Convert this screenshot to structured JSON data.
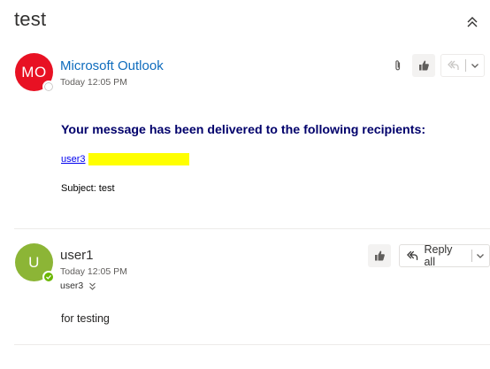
{
  "conversation": {
    "subject": "test"
  },
  "colors": {
    "accent_link": "#0f6cbd",
    "avatar_outlook": "#e81123",
    "avatar_user1": "#8cb536",
    "heading_navy": "#00006b",
    "highlight": "#ffff00",
    "presence_available": "#6bb700"
  },
  "messages": [
    {
      "avatar_initials": "MO",
      "sender": "Microsoft Outlook",
      "time": "Today 12:05 PM",
      "actions": {
        "reply_icon": "reply-all-icon"
      },
      "body": {
        "heading": "Your message has been delivered to the following recipients:",
        "recipient": "user3",
        "subject_line": "Subject: test"
      }
    },
    {
      "avatar_initials": "U",
      "sender": "user1",
      "time": "Today 12:05 PM",
      "to": "user3",
      "actions": {
        "reply_all_label": "Reply all"
      },
      "body": {
        "text": "for testing"
      }
    }
  ],
  "icons": {
    "collapse": "double-chevron-up-icon",
    "attachment": "paperclip-icon",
    "like": "thumbs-up-icon",
    "reply_all": "reply-all-icon",
    "dropdown": "chevron-down-icon",
    "expand_recipients": "double-chevron-down-icon"
  }
}
